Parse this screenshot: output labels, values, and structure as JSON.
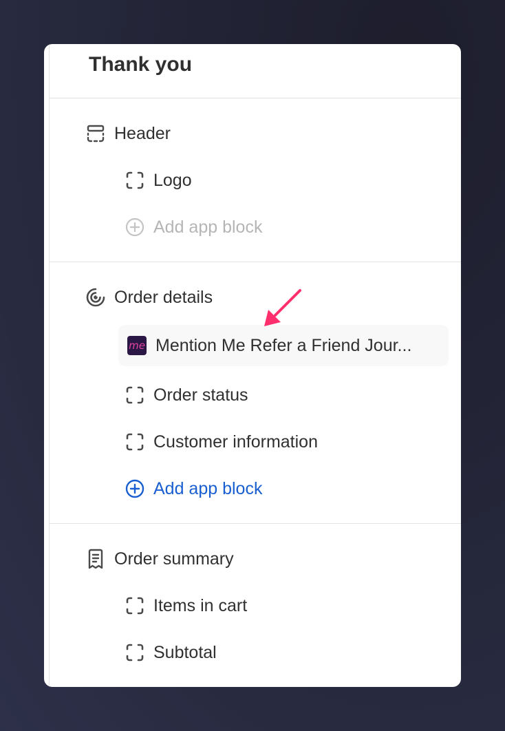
{
  "panel": {
    "title": "Thank you",
    "sections": [
      {
        "label": "Header",
        "icon": "header-layout-icon",
        "items": [
          {
            "label": "Logo",
            "icon": "dashed-square-icon"
          },
          {
            "label": "Add app block",
            "icon": "plus-circle-icon",
            "state": "disabled"
          }
        ]
      },
      {
        "label": "Order details",
        "icon": "order-details-icon",
        "items": [
          {
            "label": "Mention Me Refer a Friend Jour...",
            "icon": "mention-me-app-icon",
            "app_icon_text": "me",
            "highlighted": true
          },
          {
            "label": "Order status",
            "icon": "dashed-square-icon"
          },
          {
            "label": "Customer information",
            "icon": "dashed-square-icon"
          },
          {
            "label": "Add app block",
            "icon": "plus-circle-icon",
            "state": "active"
          }
        ]
      },
      {
        "label": "Order summary",
        "icon": "receipt-icon",
        "items": [
          {
            "label": "Items in cart",
            "icon": "dashed-square-icon"
          },
          {
            "label": "Subtotal",
            "icon": "dashed-square-icon"
          }
        ]
      }
    ]
  },
  "annotation": {
    "icon": "pointer-arrow-icon",
    "color": "#ff2f6e"
  },
  "colors": {
    "text": "#303030",
    "muted": "#b5b5b5",
    "link": "#1a5fd1",
    "app_icon_bg": "#2b1746",
    "app_icon_fg": "#e0459c"
  }
}
